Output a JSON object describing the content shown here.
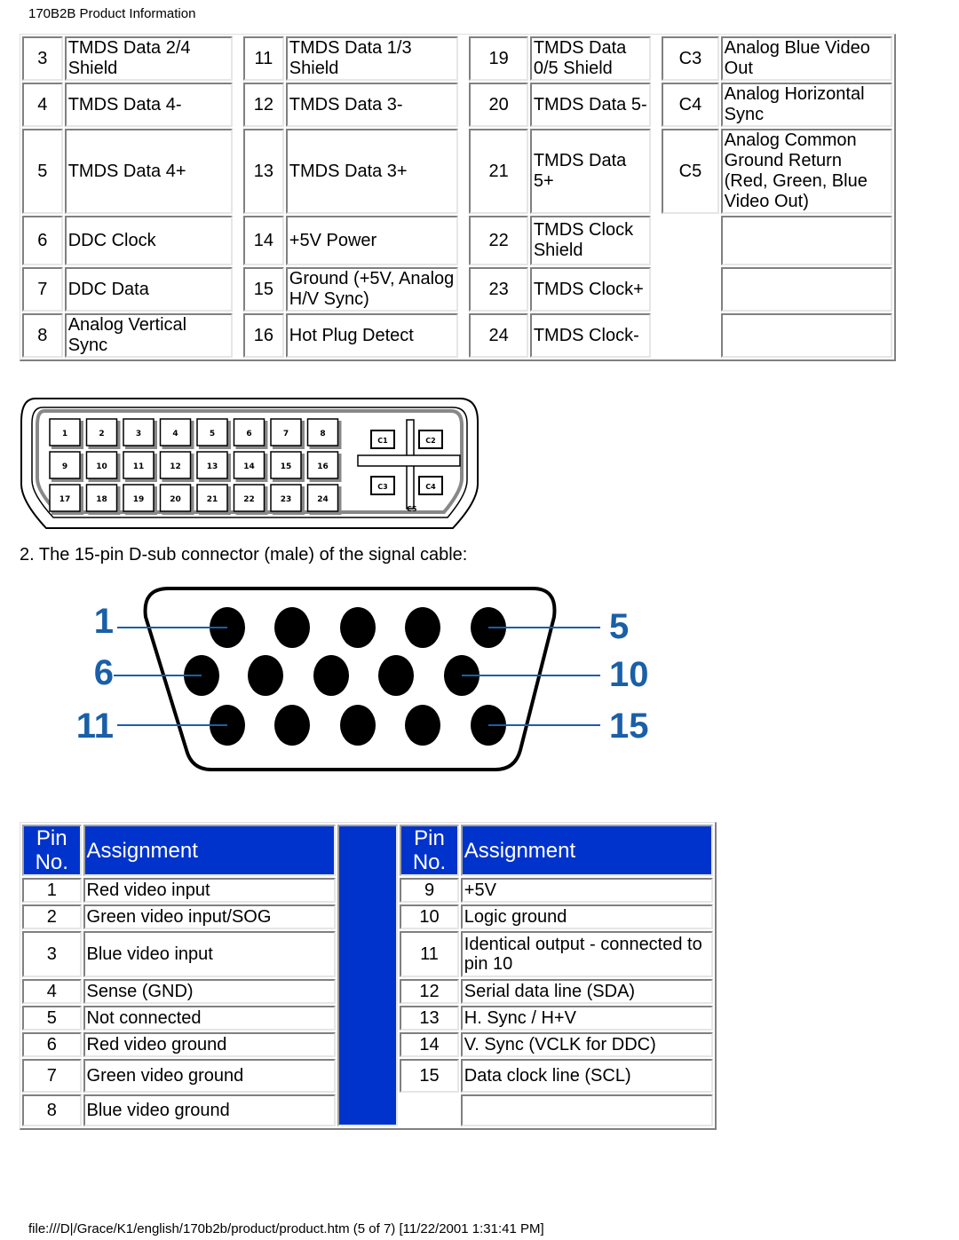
{
  "header": {
    "title": "170B2B Product Information"
  },
  "dvi_table": {
    "rows": [
      {
        "cells": [
          {
            "pin": "3",
            "desc": "TMDS Data 2/4 Shield"
          },
          {
            "pin": "11",
            "desc": "TMDS Data 1/3 Shield"
          },
          {
            "pin": "19",
            "desc": "TMDS Data 0/5 Shield"
          },
          {
            "pin": "C3",
            "desc": "Analog Blue Video Out"
          }
        ]
      },
      {
        "cells": [
          {
            "pin": "4",
            "desc": "TMDS Data 4-"
          },
          {
            "pin": "12",
            "desc": "TMDS Data 3-"
          },
          {
            "pin": "20",
            "desc": "TMDS Data 5-"
          },
          {
            "pin": "C4",
            "desc": "Analog Horizontal Sync"
          }
        ]
      },
      {
        "cells": [
          {
            "pin": "5",
            "desc": "TMDS Data 4+"
          },
          {
            "pin": "13",
            "desc": "TMDS Data 3+"
          },
          {
            "pin": "21",
            "desc": "TMDS Data 5+"
          },
          {
            "pin": "C5",
            "desc": "Analog Common Ground Return (Red, Green, Blue Video Out)"
          }
        ]
      },
      {
        "cells": [
          {
            "pin": "6",
            "desc": "DDC Clock"
          },
          {
            "pin": "14",
            "desc": "+5V Power"
          },
          {
            "pin": "22",
            "desc": "TMDS Clock Shield"
          },
          {
            "pin": "",
            "desc": ""
          }
        ]
      },
      {
        "cells": [
          {
            "pin": "7",
            "desc": "DDC Data"
          },
          {
            "pin": "15",
            "desc": "Ground (+5V, Analog H/V Sync)"
          },
          {
            "pin": "23",
            "desc": "TMDS Clock+"
          },
          {
            "pin": "",
            "desc": ""
          }
        ]
      },
      {
        "cells": [
          {
            "pin": "8",
            "desc": "Analog Vertical Sync"
          },
          {
            "pin": "16",
            "desc": "Hot Plug Detect"
          },
          {
            "pin": "24",
            "desc": "TMDS Clock-"
          },
          {
            "pin": "",
            "desc": ""
          }
        ]
      }
    ]
  },
  "dvi_connector": {
    "pins": [
      "1",
      "2",
      "3",
      "4",
      "5",
      "6",
      "7",
      "8",
      "9",
      "10",
      "11",
      "12",
      "13",
      "14",
      "15",
      "16",
      "17",
      "18",
      "19",
      "20",
      "21",
      "22",
      "23",
      "24"
    ],
    "analog_pins": [
      "C1",
      "C2",
      "C3",
      "C4"
    ],
    "center_pin": "C5"
  },
  "caption": "2. The 15-pin D-sub connector (male) of the signal cable:",
  "vga_connector": {
    "labels": {
      "row1_left": "1",
      "row1_right": "5",
      "row2_left": "6",
      "row2_right": "10",
      "row3_left": "11",
      "row3_right": "15"
    },
    "label_color": "#1a5fa8"
  },
  "vga_table": {
    "headers": {
      "pin": "Pin No.",
      "pin_line1": "Pin",
      "pin_line2": "No.",
      "assignment": "Assignment"
    },
    "header_color": "#0033cc",
    "left": [
      {
        "pin": "1",
        "desc": "Red video input"
      },
      {
        "pin": "2",
        "desc": "Green video input/SOG"
      },
      {
        "pin": "3",
        "desc": "Blue video input"
      },
      {
        "pin": "4",
        "desc": "Sense (GND)"
      },
      {
        "pin": "5",
        "desc": "Not connected"
      },
      {
        "pin": "6",
        "desc": "Red video ground"
      },
      {
        "pin": "7",
        "desc": "Green video ground"
      },
      {
        "pin": "8",
        "desc": "Blue video ground"
      }
    ],
    "right": [
      {
        "pin": "9",
        "desc": "+5V"
      },
      {
        "pin": "10",
        "desc": "Logic ground"
      },
      {
        "pin": "11",
        "desc": "Identical output - connected to pin 10"
      },
      {
        "pin": "12",
        "desc": "Serial data line (SDA)"
      },
      {
        "pin": "13",
        "desc": "H. Sync / H+V"
      },
      {
        "pin": "14",
        "desc": "V. Sync (VCLK for DDC)"
      },
      {
        "pin": "15",
        "desc": "Data clock line (SCL)"
      },
      {
        "pin": "",
        "desc": ""
      }
    ]
  },
  "footer": {
    "text": "file:///D|/Grace/K1/english/170b2b/product/product.htm (5 of 7) [11/22/2001 1:31:41 PM]"
  }
}
